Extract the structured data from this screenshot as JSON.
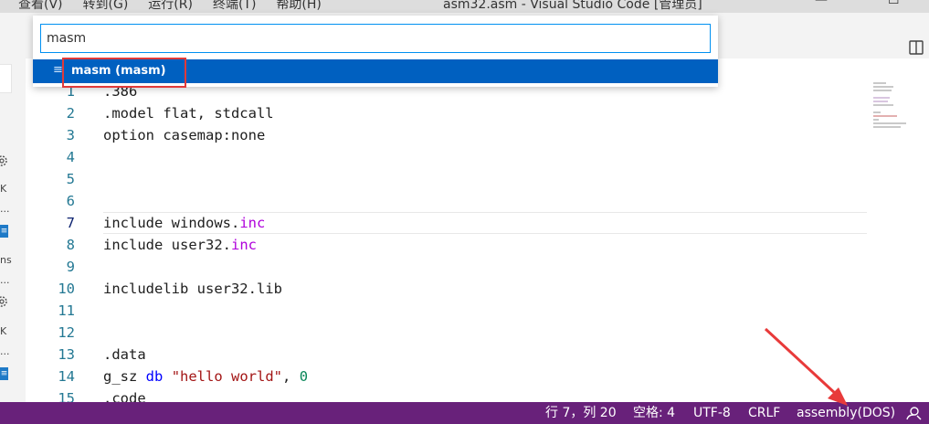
{
  "window": {
    "menu": [
      "查看(V)",
      "转到(G)",
      "运行(R)",
      "终端(T)",
      "帮助(H)"
    ],
    "title": "asm32.asm - Visual Studio Code [管理员]"
  },
  "palette": {
    "input_value": "masm",
    "item_label": "masm  (masm)"
  },
  "sidebar": {
    "texts": [
      "·",
      "K",
      "...",
      "ns",
      "...",
      "K",
      "..."
    ]
  },
  "editor": {
    "lines": [
      {
        "num": "1",
        "code": ".386"
      },
      {
        "num": "2",
        "code": ".model flat, stdcall"
      },
      {
        "num": "3",
        "code": "option casemap:none"
      },
      {
        "num": "4",
        "code": ""
      },
      {
        "num": "5",
        "code": ""
      },
      {
        "num": "6",
        "code": ""
      },
      {
        "num": "7",
        "code_a": "include windows.",
        "code_b": "inc"
      },
      {
        "num": "8",
        "code_a": "include user32.",
        "code_b": "inc"
      },
      {
        "num": "9",
        "code": ""
      },
      {
        "num": "10",
        "code": "includelib user32.lib"
      },
      {
        "num": "11",
        "code": ""
      },
      {
        "num": "12",
        "code": ""
      },
      {
        "num": "13",
        "code": ".data"
      },
      {
        "num": "14",
        "code_a": "g_sz ",
        "code_b": "db",
        "code_c": " ",
        "code_d": "\"hello world\"",
        "code_e": ", ",
        "code_f": "0"
      },
      {
        "num": "15",
        "code": ".code"
      }
    ]
  },
  "statusbar": {
    "position": "行 7，列 20",
    "spaces": "空格: 4",
    "encoding": "UTF-8",
    "eol": "CRLF",
    "language": "assembly(DOS)"
  },
  "colors": {
    "statusbar_bg": "#68217a",
    "selection_bg": "#0060c0",
    "annotation_red": "#e03a3a"
  }
}
